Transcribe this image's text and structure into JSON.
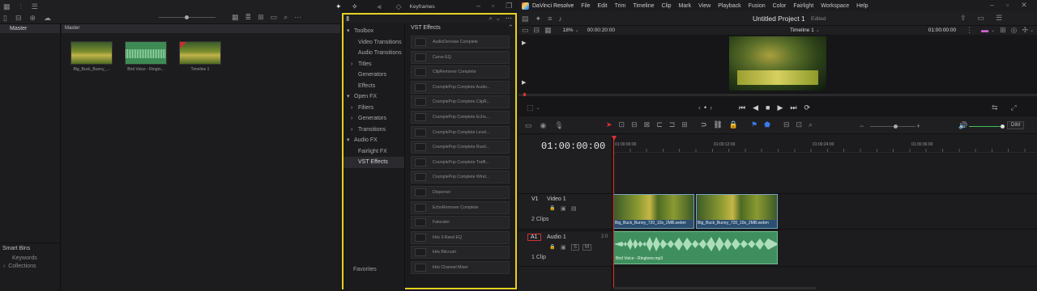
{
  "media_pool": {
    "bins_header": "Master",
    "main_header": "Master",
    "clips": [
      {
        "name": "Big_Buck_Bunny_...",
        "kind": "video"
      },
      {
        "name": "Bird Voice - Ringto...",
        "kind": "audio"
      },
      {
        "name": "Timeline 1",
        "kind": "timeline"
      }
    ],
    "smart_bins": "Smart Bins",
    "smart_bin_items": [
      "Keywords",
      "Collections"
    ]
  },
  "effects": {
    "keyframes_label": "Keyframes",
    "categories": [
      {
        "label": "Toolbox",
        "indent": 0,
        "arrow": "▾"
      },
      {
        "label": "Video Transitions",
        "indent": 1,
        "arrow": ""
      },
      {
        "label": "Audio Transitions",
        "indent": 1,
        "arrow": ""
      },
      {
        "label": "Titles",
        "indent": 1,
        "arrow": "›"
      },
      {
        "label": "Generators",
        "indent": 1,
        "arrow": ""
      },
      {
        "label": "Effects",
        "indent": 1,
        "arrow": ""
      },
      {
        "label": "Open FX",
        "indent": 0,
        "arrow": "▾"
      },
      {
        "label": "Filters",
        "indent": 1,
        "arrow": "›"
      },
      {
        "label": "Generators",
        "indent": 1,
        "arrow": "›"
      },
      {
        "label": "Transitions",
        "indent": 1,
        "arrow": "›"
      },
      {
        "label": "Audio FX",
        "indent": 0,
        "arrow": "▾"
      },
      {
        "label": "Fairlight FX",
        "indent": 1,
        "arrow": ""
      },
      {
        "label": "VST Effects",
        "indent": 1,
        "arrow": "",
        "selected": true
      }
    ],
    "favorites": "Favorites",
    "list_title": "VST Effects",
    "items": [
      "AudioDenoise Complete",
      "Carve EQ",
      "ClipRemover Complete",
      "CrumplePop Complete Audio...",
      "CrumplePop Complete ClipR...",
      "CrumplePop Complete Echo...",
      "CrumplePop Complete Level...",
      "CrumplePop Complete Rustl...",
      "CrumplePop Complete Traffi...",
      "CrumplePop Complete Wind...",
      "Disperser",
      "EchoRemover Complete",
      "Faturator",
      "kHs 3-Band EQ",
      "kHs Bitcrush",
      "kHs Channel Mixer"
    ]
  },
  "app": {
    "name": "DaVinci Resolve",
    "menu": [
      "File",
      "Edit",
      "Trim",
      "Timeline",
      "Clip",
      "Mark",
      "View",
      "Playback",
      "Fusion",
      "Color",
      "Fairlight",
      "Workspace",
      "Help"
    ],
    "project_title": "Untitled Project 1",
    "project_status": "Edited"
  },
  "viewer": {
    "zoom": "18%",
    "source_tc": "00:00:20:00",
    "timeline_name": "Timeline 1",
    "record_tc": "01:00:00:00"
  },
  "timeline": {
    "timecode": "01:00:00:00",
    "ruler": [
      "01:00:00:00",
      "01:00:12:00",
      "01:00:24:00",
      "01:00:36:00"
    ],
    "dim_label": "DIM",
    "video_track": {
      "id": "V1",
      "name": "Video 1",
      "count": "2 Clips",
      "clips": [
        "Big_Buck_Bunny_720_10s_2MB.webm",
        "Big_Buck_Bunny_720_10s_2MB.webm"
      ]
    },
    "audio_track": {
      "id": "A1",
      "name": "Audio 1",
      "level": "2.0",
      "count": "1 Clip",
      "clip": "Bird Voice - Ringtone.mp3"
    }
  },
  "colors": {
    "highlight": "#e4d321",
    "playhead": "#e0302b",
    "audio_clip": "#3f8f5e",
    "video_clip": "#2c4f70"
  }
}
